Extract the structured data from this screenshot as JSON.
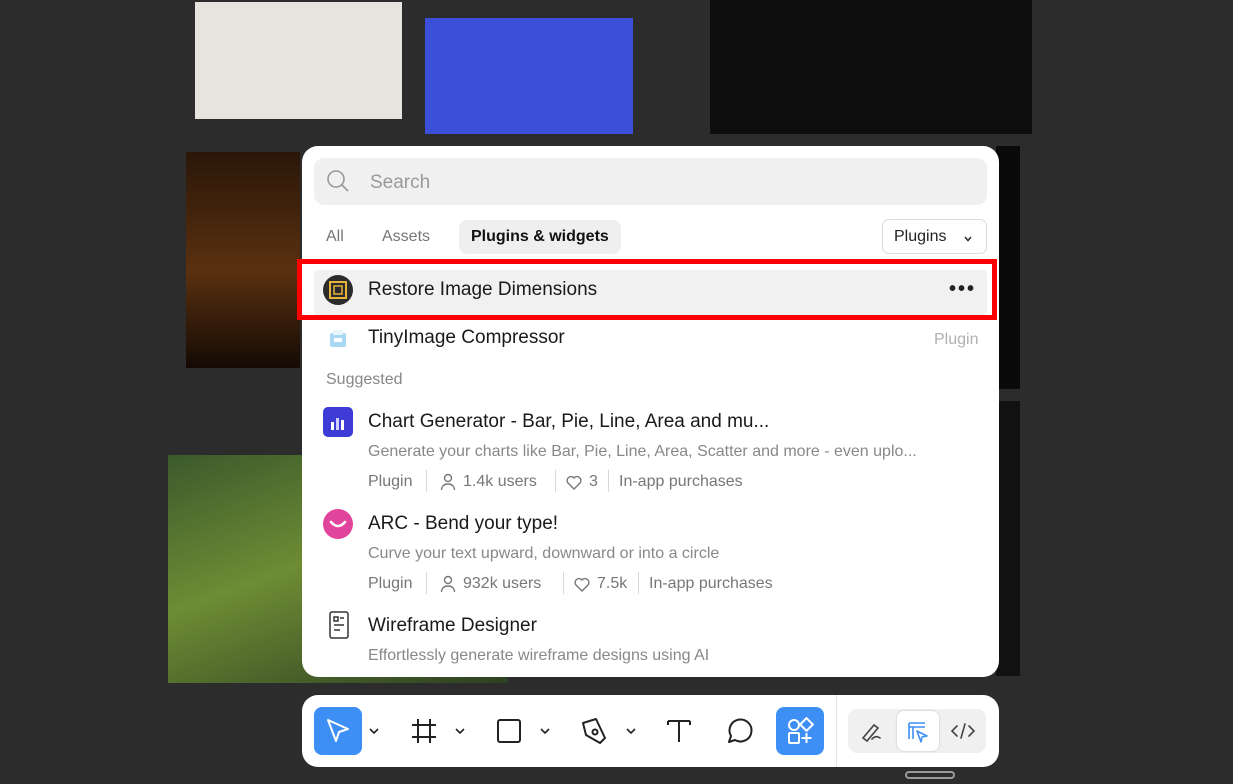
{
  "search": {
    "placeholder": "Search"
  },
  "tabs": [
    {
      "label": "All"
    },
    {
      "label": "Assets"
    },
    {
      "label": "Plugins & widgets"
    }
  ],
  "filter": {
    "label": "Plugins"
  },
  "recent": [
    {
      "title": "Restore Image Dimensions",
      "icon": "restore-dimensions-icon"
    },
    {
      "title": "TinyImage Compressor",
      "badge": "Plugin",
      "icon": "tinyimage-icon"
    }
  ],
  "suggested_heading": "Suggested",
  "suggested": [
    {
      "title": "Chart Generator - Bar, Pie, Line, Area and mu...",
      "desc": "Generate your charts like Bar, Pie, Line, Area, Scatter and more - even uplo...",
      "type": "Plugin",
      "users": "1.4k users",
      "likes": "3",
      "purchase": "In-app purchases"
    },
    {
      "title": "ARC - Bend your type!",
      "desc": "Curve your text upward, downward or into a circle",
      "type": "Plugin",
      "users": "932k users",
      "likes": "7.5k",
      "purchase": "In-app purchases"
    },
    {
      "title": "Wireframe Designer",
      "desc": "Effortlessly generate wireframe designs using AI"
    }
  ],
  "colors": {
    "accent": "#3d8ff5",
    "highlight": "#ff0000",
    "canvas": "#2c2c2c"
  }
}
